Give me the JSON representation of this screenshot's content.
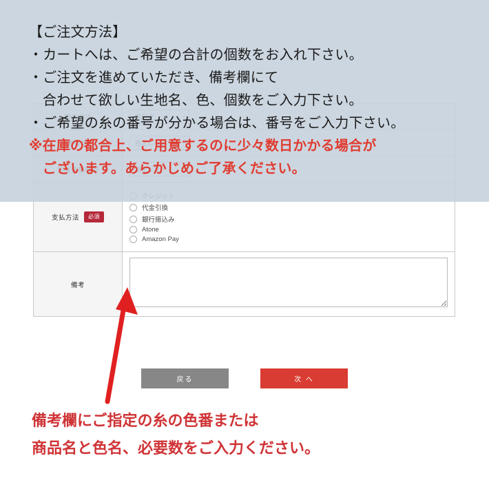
{
  "instructions": {
    "heading": "【ご注文方法】",
    "lines": [
      "・カートへは、ご希望の合計の個数をお入れ下さい。",
      "・ご注文を進めていただき、備考欄にて",
      "合わせて欲しい生地名、色、個数をご入力下さい。",
      "・ご希望の糸の番号が分かる場合は、番号をご入力下さい。"
    ],
    "note_line_1": "※在庫の都合上、ご用意するのに少々数日かかる場合が",
    "note_line_2": "ございます。あらかじめご了承ください。"
  },
  "form": {
    "rows": [
      {
        "label": "配送方法",
        "required": false,
        "control": "select",
        "value": "宅配便"
      },
      {
        "label": "到着希望日",
        "required": false,
        "control": "select",
        "value": "指定しない"
      },
      {
        "label": "到着希望時間",
        "required": false,
        "control": "select",
        "value": "指定しない"
      }
    ],
    "payment": {
      "label": "支払方法",
      "required_badge": "必須",
      "options": [
        "クレジット",
        "代金引換",
        "銀行振込み",
        "Atone",
        "Amazon Pay"
      ]
    },
    "remarks": {
      "label": "備考",
      "value": "",
      "placeholder": ""
    },
    "caret_glyph": "▼"
  },
  "buttons": {
    "back_label": "戻る",
    "next_label": "次 へ"
  },
  "caption": {
    "line_1": "備考欄にご指定の糸の色番または",
    "line_2": "商品名と色名、必要数をご入力ください。"
  },
  "colors": {
    "accent_red": "#cf3336",
    "button_red": "#d93c32",
    "button_gray": "#878787",
    "badge_red": "#b5293a",
    "overlay": "#c5d0dc",
    "note_red": "#e03c31"
  }
}
